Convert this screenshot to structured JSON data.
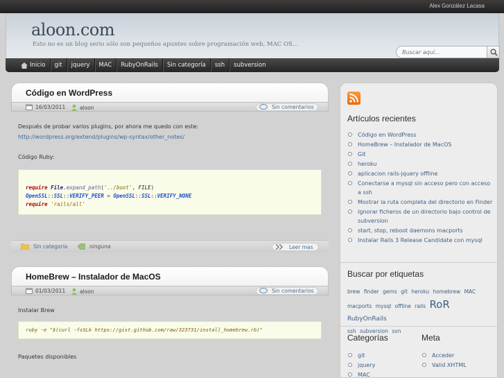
{
  "topbar": {
    "user": "Alex González Lacasa"
  },
  "header": {
    "title": "aloon.com",
    "description": "Esto no es un blog serio sólo son pequeños apuntes sobre programación web, MAC OS…",
    "search_placeholder": "Buscar aquí..."
  },
  "nav": {
    "items": [
      "Inicio",
      "git",
      "jquery",
      "MAC",
      "RubyOnRails",
      "Sin categoría",
      "ssh",
      "subversion"
    ]
  },
  "posts": [
    {
      "title": "Código en WordPress",
      "date": "16/03/2011",
      "author": "aloon",
      "comments": "Sin comentarios",
      "body_1": "Después de probar varios plugins, por ahora me quedo con este:",
      "link": "http://wordpress.org/extend/plugins/wp-syntax/other_notes/",
      "body_2": "Código Ruby:",
      "code": {
        "l1": {
          "kw": "require",
          "cls": "File",
          "fn": "expand_path",
          "str": "'../boot'",
          "rest": "FILE"
        },
        "l2": {
          "a": "OpenSSL",
          "b": "SSL",
          "c": "VERIFY_PEER",
          "d": "OpenSSL",
          "e": "SSL",
          "f": "VERIFY_NONE"
        },
        "l3": {
          "kw": "require",
          "str": "'rails/all'"
        }
      },
      "category": "Sin categoría",
      "tags": "ninguna",
      "read_more": "Leer mas"
    },
    {
      "title": "HomeBrew – Instalador de MacOS",
      "date": "01/03/2011",
      "author": "aloon",
      "comments": "Sin comentarios",
      "body_1": "Instalar Brew",
      "code_line": "ruby -e \"$(curl -fsSLk https://gist.github.com/raw/323731/install_homebrew.rb)\"",
      "body_2": "Paquetes disponibles"
    }
  ],
  "sidebar": {
    "recent_title": "Artículos recientes",
    "recent": [
      "Código en WordPress",
      "HomeBrew – Instalador de MacOS",
      "Git",
      "heroku",
      "aplicacion rails-jquery offline",
      "Conectarse a mysql sin acceso pero con acceso a ssh",
      "Mostrar la ruta completa del directorio en Finder",
      "Ignorar ficheros de un directorio bajo control de subversion",
      "start, stop, reboot daemons macports",
      "Instalar Rails 3 Release Candidate con mysql"
    ],
    "tags_title": "Buscar por etiquetas",
    "tags": {
      "t1": "brew",
      "t2": "finder",
      "t3": "gems",
      "t4": "git",
      "t5": "heroku",
      "t6": "homebrew",
      "t7": "MAC",
      "t8": "macports",
      "t9": "mysql",
      "t10": "offline",
      "t11": "rails",
      "t12": "RoR",
      "t13": "RubyOnRails",
      "t14": "ssh",
      "t15": "subversion",
      "t16": "svn"
    },
    "categories_title": "Categorías",
    "categories": [
      "git",
      "jquery",
      "MAC"
    ],
    "meta_title": "Meta",
    "meta": [
      "Acceder",
      "Valid XHTML"
    ]
  }
}
